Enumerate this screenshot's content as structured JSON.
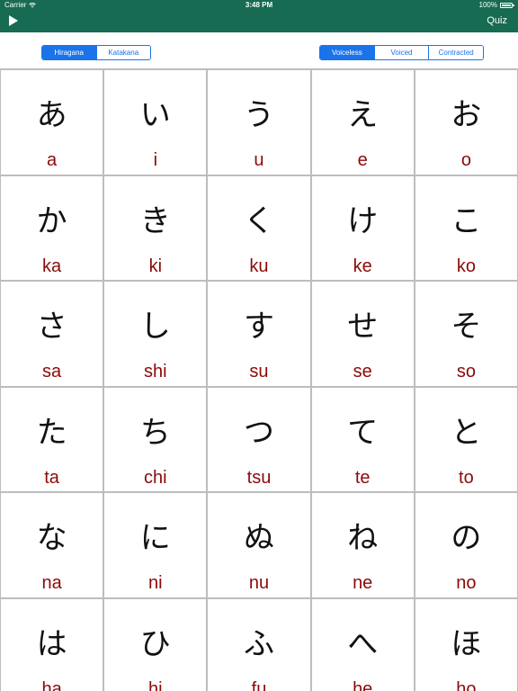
{
  "status_bar": {
    "carrier": "Carrier",
    "time": "3:48 PM",
    "battery": "100%"
  },
  "nav": {
    "play_icon": "play-icon",
    "quiz_label": "Quiz"
  },
  "script_selector": {
    "options": [
      "Hiragana",
      "Katakana"
    ],
    "selected": "Hiragana"
  },
  "sound_selector": {
    "options": [
      "Voiceless",
      "Voiced",
      "Contracted"
    ],
    "selected": "Voiceless"
  },
  "colors": {
    "header": "#176b52",
    "accent": "#1a73e8",
    "romaji": "#8b0a0a"
  },
  "kana_rows": [
    [
      {
        "kana": "あ",
        "romaji": "a"
      },
      {
        "kana": "い",
        "romaji": "i"
      },
      {
        "kana": "う",
        "romaji": "u"
      },
      {
        "kana": "え",
        "romaji": "e"
      },
      {
        "kana": "お",
        "romaji": "o"
      }
    ],
    [
      {
        "kana": "か",
        "romaji": "ka"
      },
      {
        "kana": "き",
        "romaji": "ki"
      },
      {
        "kana": "く",
        "romaji": "ku"
      },
      {
        "kana": "け",
        "romaji": "ke"
      },
      {
        "kana": "こ",
        "romaji": "ko"
      }
    ],
    [
      {
        "kana": "さ",
        "romaji": "sa"
      },
      {
        "kana": "し",
        "romaji": "shi"
      },
      {
        "kana": "す",
        "romaji": "su"
      },
      {
        "kana": "せ",
        "romaji": "se"
      },
      {
        "kana": "そ",
        "romaji": "so"
      }
    ],
    [
      {
        "kana": "た",
        "romaji": "ta"
      },
      {
        "kana": "ち",
        "romaji": "chi"
      },
      {
        "kana": "つ",
        "romaji": "tsu"
      },
      {
        "kana": "て",
        "romaji": "te"
      },
      {
        "kana": "と",
        "romaji": "to"
      }
    ],
    [
      {
        "kana": "な",
        "romaji": "na"
      },
      {
        "kana": "に",
        "romaji": "ni"
      },
      {
        "kana": "ぬ",
        "romaji": "nu"
      },
      {
        "kana": "ね",
        "romaji": "ne"
      },
      {
        "kana": "の",
        "romaji": "no"
      }
    ],
    [
      {
        "kana": "は",
        "romaji": "ha"
      },
      {
        "kana": "ひ",
        "romaji": "hi"
      },
      {
        "kana": "ふ",
        "romaji": "fu"
      },
      {
        "kana": "へ",
        "romaji": "he"
      },
      {
        "kana": "ほ",
        "romaji": "ho"
      }
    ]
  ]
}
